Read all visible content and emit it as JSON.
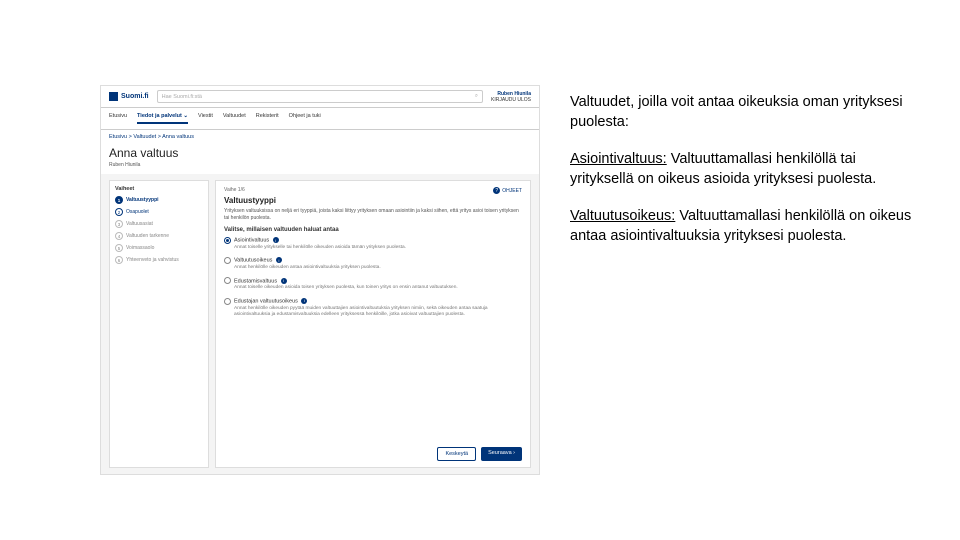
{
  "screenshot": {
    "logo_text": "Suomi.fi",
    "search_placeholder": "Hae Suomi.fi:stä",
    "search_icon": "⌕",
    "user_name": "Ruben Hiunila",
    "user_action": "KIRJAUDU ULOS",
    "nav": [
      "Etusivu",
      "Tiedot ja palvelut",
      "Viestit",
      "Valtuudet",
      "Rekisterit",
      "Ohjeet ja tuki"
    ],
    "nav_caret": "⌄",
    "breadcrumb": [
      "Etusivu",
      "Valtuudet",
      "Anna valtuus"
    ],
    "page_title": "Anna valtuus",
    "page_subtitle": "Ruben Hiunila",
    "stepper_title": "Vaiheet",
    "steps": [
      {
        "n": "1",
        "label": "Valtuustyyppi"
      },
      {
        "n": "2",
        "label": "Osapuolet"
      },
      {
        "n": "3",
        "label": "Valtuusasiat"
      },
      {
        "n": "4",
        "label": "Valtuuden tarkenne"
      },
      {
        "n": "5",
        "label": "Voimassaolo"
      },
      {
        "n": "6",
        "label": "Yhteenveto ja vahvistus"
      }
    ],
    "panel_step_label": "Vaihe 1/6",
    "panel_help": "OHJEET",
    "panel_title": "Valtuustyyppi",
    "panel_intro": "Yrityksen valtuuksissa on neljä eri tyyppiä, joista kaksi liittyy yrityksen omaan asiointiin ja kaksi siihen, että yritys asioi toisen yrityksen tai henkilön puolesta.",
    "panel_subtitle": "Valitse, millaisen valtuuden haluat antaa",
    "options": [
      {
        "label": "Asiointivaltuus",
        "desc": "Annat toiselle yritykselle tai henkilölle oikeuden asioida tämän yrityksen puolesta."
      },
      {
        "label": "Valtuutusoikeus",
        "desc": "Annat henkilölle oikeuden antaa asiointivaltuuksia yrityksen puolesta."
      },
      {
        "label": "Edustamisvaltuus",
        "desc": "Annat toiselle oikeuden asioida toisen yrityksen puolesta, kun toinen yritys on ensin antanut valtuutuksen."
      },
      {
        "label": "Edustajan valtuutusoikeus",
        "desc": "Annat henkilölle oikeuden pyytää muiden valtuuttajien asiointivaltuutuksia yrityksen nimiin, sekä oikeuden antaa saatuja asiointivaltuuksia ja edustamisvaltuuksia edelleen yrityksessä henkilöille, jotka asioivat valtuuttajien puolesta."
      }
    ],
    "btn_back": "Keskeytä",
    "btn_next": "Seuraava",
    "btn_next_arrow": "›"
  },
  "text": {
    "p1": "Valtuudet, joilla voit antaa oikeuksia oman yrityksesi puolesta:",
    "p2_label": "Asiointivaltuus:",
    "p2_body": " Valtuuttamallasi henkilöllä tai yrityksellä on oikeus asioida yrityksesi puolesta.",
    "p3_label": "Valtuutusoikeus:",
    "p3_body": " Valtuuttamallasi henkilöllä on oikeus antaa asiointivaltuuksia yrityksesi puolesta."
  }
}
